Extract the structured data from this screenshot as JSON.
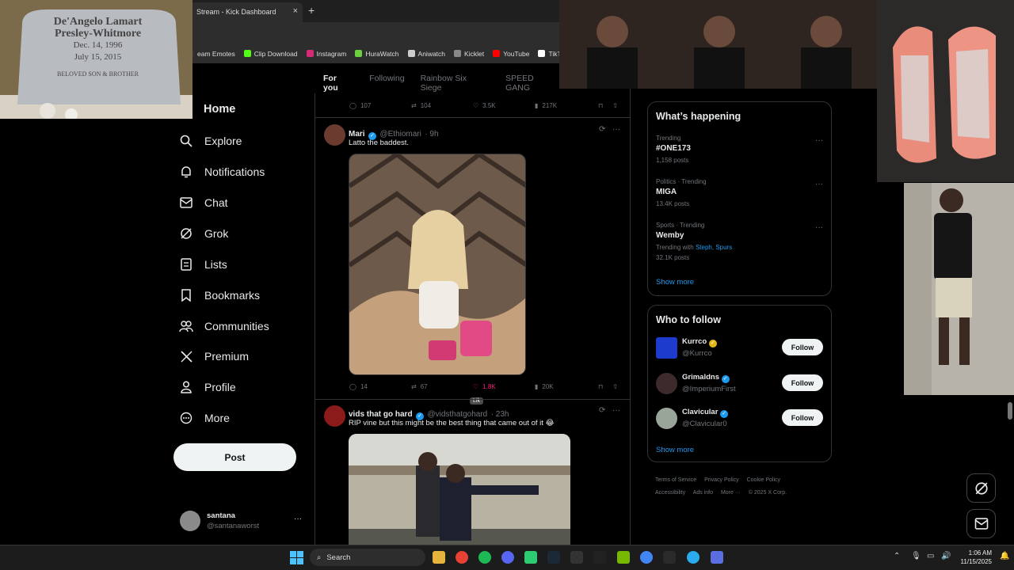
{
  "browser": {
    "tab_title": "Stream - Kick Dashboard",
    "tab_close": "×",
    "new_tab": "+",
    "bookmarks": [
      {
        "label": "eam Emotes",
        "color": "#333333"
      },
      {
        "label": "Clip Download",
        "color": "#53fc18"
      },
      {
        "label": "Instagram",
        "color": "#d62976"
      },
      {
        "label": "HuraWatch",
        "color": "#6ccf3f"
      },
      {
        "label": "Aniwatch",
        "color": "#cccccc"
      },
      {
        "label": "Kicklet",
        "color": "#888888"
      },
      {
        "label": "YouTube",
        "color": "#ff0000"
      },
      {
        "label": "TikTok",
        "color": "#ffffff"
      }
    ]
  },
  "memorial_overlay": {
    "line1": "De'Angelo Lamart",
    "line2": "Presley-Whitmore",
    "line3": "Dec. 14, 1996",
    "line4": "July 15, 2015",
    "line5": "BELOVED SON & BROTHER"
  },
  "nav": {
    "items": [
      {
        "label": "Home",
        "icon": "home-icon"
      },
      {
        "label": "Explore",
        "icon": "search-icon"
      },
      {
        "label": "Notifications",
        "icon": "bell-icon"
      },
      {
        "label": "Chat",
        "icon": "mail-icon"
      },
      {
        "label": "Grok",
        "icon": "grok-icon"
      },
      {
        "label": "Lists",
        "icon": "list-icon"
      },
      {
        "label": "Bookmarks",
        "icon": "bookmark-icon"
      },
      {
        "label": "Communities",
        "icon": "people-icon"
      },
      {
        "label": "Premium",
        "icon": "x-icon"
      },
      {
        "label": "Profile",
        "icon": "person-icon"
      },
      {
        "label": "More",
        "icon": "more-icon"
      }
    ],
    "post_label": "Post"
  },
  "account": {
    "name": "santana",
    "handle": "@santanaworst",
    "menu": "···"
  },
  "feed": {
    "tabs": [
      "For you",
      "Following",
      "Rainbow Six Siege",
      "SPEED GANG"
    ],
    "prev_tweet_actions": {
      "replies": "107",
      "reposts": "104",
      "likes": "3.5K",
      "views": "217K"
    },
    "tweets": [
      {
        "name": "Mari",
        "handle": "@Ethiomari",
        "time": "· 9h",
        "text": "Latto the baddest.",
        "replies": "14",
        "reposts": "67",
        "likes": "1.8K",
        "views": "20K"
      },
      {
        "name": "vids that go hard",
        "handle": "@vidsthatgohard",
        "time": "· 23h",
        "text": "RIP vine but this might be the best thing that came out of it 😂"
      }
    ],
    "tooltip": "Lik"
  },
  "trends": {
    "title": "What’s happening",
    "items": [
      {
        "meta": "Trending",
        "name": "#ONE173",
        "posts": "1,158 posts"
      },
      {
        "meta": "Politics · Trending",
        "name": "MIGA",
        "posts": "13.4K posts"
      },
      {
        "meta": "Sports · Trending",
        "name": "Wemby",
        "with_prefix": "Trending with",
        "with_links": "Steph, Spurs",
        "posts": "32.1K posts"
      }
    ],
    "show_more": "Show more"
  },
  "who_to_follow": {
    "title": "Who to follow",
    "users": [
      {
        "name": "Kurrco",
        "handle": "@Kurrco",
        "badge": "gold",
        "button": "Follow"
      },
      {
        "name": "Grimaldns",
        "handle": "@ImperiumFirst",
        "badge": "blue",
        "button": "Follow"
      },
      {
        "name": "Clavicular",
        "handle": "@Clavicular0",
        "badge": "blue",
        "button": "Follow"
      }
    ],
    "show_more": "Show more"
  },
  "footer": {
    "links": [
      "Terms of Service",
      "Privacy Policy",
      "Cookie Policy",
      "Accessibility",
      "Ads info",
      "More ···"
    ],
    "copyright": "© 2025 X Corp."
  },
  "taskbar": {
    "search_label": "Search",
    "time": "1:06 AM",
    "date": "11/15/2025"
  },
  "colors": {
    "accent": "#1d9bf0",
    "like": "#f91880",
    "background": "#000000"
  }
}
